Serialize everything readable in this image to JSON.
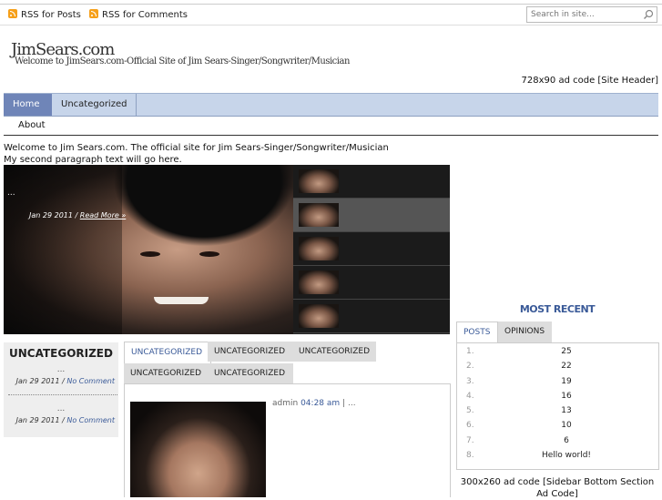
{
  "topbar": {
    "rss_posts": "RSS for Posts",
    "rss_comments": "RSS for Comments",
    "search_placeholder": "Search in site..."
  },
  "site": {
    "title": "JimSears.com",
    "tagline": "Welcome to JimSears.com-Official Site of Jim Sears-Singer/Songwriter/Musician",
    "header_ad": "728x90 ad code [Site Header]"
  },
  "nav": {
    "items": [
      "Home",
      "Uncategorized"
    ],
    "sub_items": [
      "About"
    ]
  },
  "welcome": {
    "line1": "Welcome to Jim Sears.com. The official site for Jim Sears-Singer/Songwriter/Musician",
    "line2": "My second paragraph text will go here."
  },
  "slider": {
    "dots": "...",
    "date": "Jan 29 2011",
    "sep": "/",
    "read_more": "Read More »",
    "thumb_count": 5,
    "active_thumb": 1
  },
  "uncategorized": {
    "title": "UNCATEGORIZED",
    "entries": [
      {
        "excerpt": "...",
        "date": "Jan 29 2011",
        "sep": "/",
        "comments": "No Comment"
      },
      {
        "excerpt": "...",
        "date": "Jan 29 2011",
        "sep": "/",
        "comments": "No Comment"
      }
    ]
  },
  "content_tabs": {
    "row1": [
      "UNCATEGORIZED",
      "UNCATEGORIZED",
      "UNCATEGORIZED"
    ],
    "row2": [
      "UNCATEGORIZED",
      "UNCATEGORIZED"
    ]
  },
  "post": {
    "author": "admin",
    "time": "04:28 am",
    "sep": "|",
    "excerpt": "..."
  },
  "most_recent": {
    "title": "MOST RECENT",
    "tabs": [
      "POSTS",
      "OPINIONS"
    ],
    "items": [
      {
        "num": "1.",
        "value": "25"
      },
      {
        "num": "2.",
        "value": "22"
      },
      {
        "num": "3.",
        "value": "19"
      },
      {
        "num": "4.",
        "value": "16"
      },
      {
        "num": "5.",
        "value": "13"
      },
      {
        "num": "6.",
        "value": "10"
      },
      {
        "num": "7.",
        "value": "6"
      },
      {
        "num": "8.",
        "value": "Hello world!"
      }
    ]
  },
  "sidebar_ad": "300x260 ad code [Sidebar Bottom Section Ad Code]",
  "colors": {
    "accent": "#3a5a98",
    "nav_bg": "#c7d5ea",
    "nav_active": "#6f85b8",
    "rss": "#f6a01a"
  }
}
